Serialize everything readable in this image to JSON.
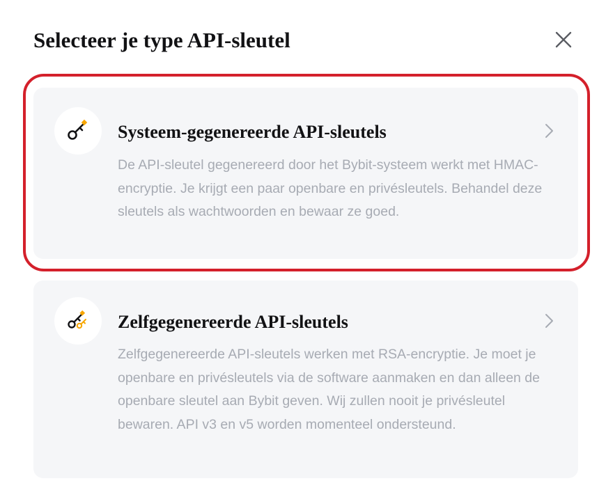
{
  "modal": {
    "title": "Selecteer je type API-sleutel",
    "close_icon": "close-icon"
  },
  "options": [
    {
      "title": "Systeem-gegenereerde API-sleutels",
      "description": "De API-sleutel gegenereerd door het Bybit-systeem werkt met HMAC-encryptie. Je krijgt een paar openbare en privésleutels. Behandel deze sleutels als wachtwoorden en bewaar ze goed.",
      "icon": "key-icon",
      "highlighted": true
    },
    {
      "title": "Zelfgegenereerde API-sleutels",
      "description": "Zelfgegenereerde API-sleutels werken met RSA-encryptie. Je moet je openbare en privésleutels via de software aanmaken en dan alleen de openbare sleutel aan Bybit geven. Wij zullen nooit je privésleutel bewaren. API v3 en v5 worden momenteel ondersteund.",
      "icon": "key-pair-icon",
      "highlighted": false
    }
  ],
  "colors": {
    "highlight": "#d4202b",
    "key_accent": "#f7a600",
    "card_background": "#f5f6f8",
    "description_text": "#a7abb3"
  }
}
